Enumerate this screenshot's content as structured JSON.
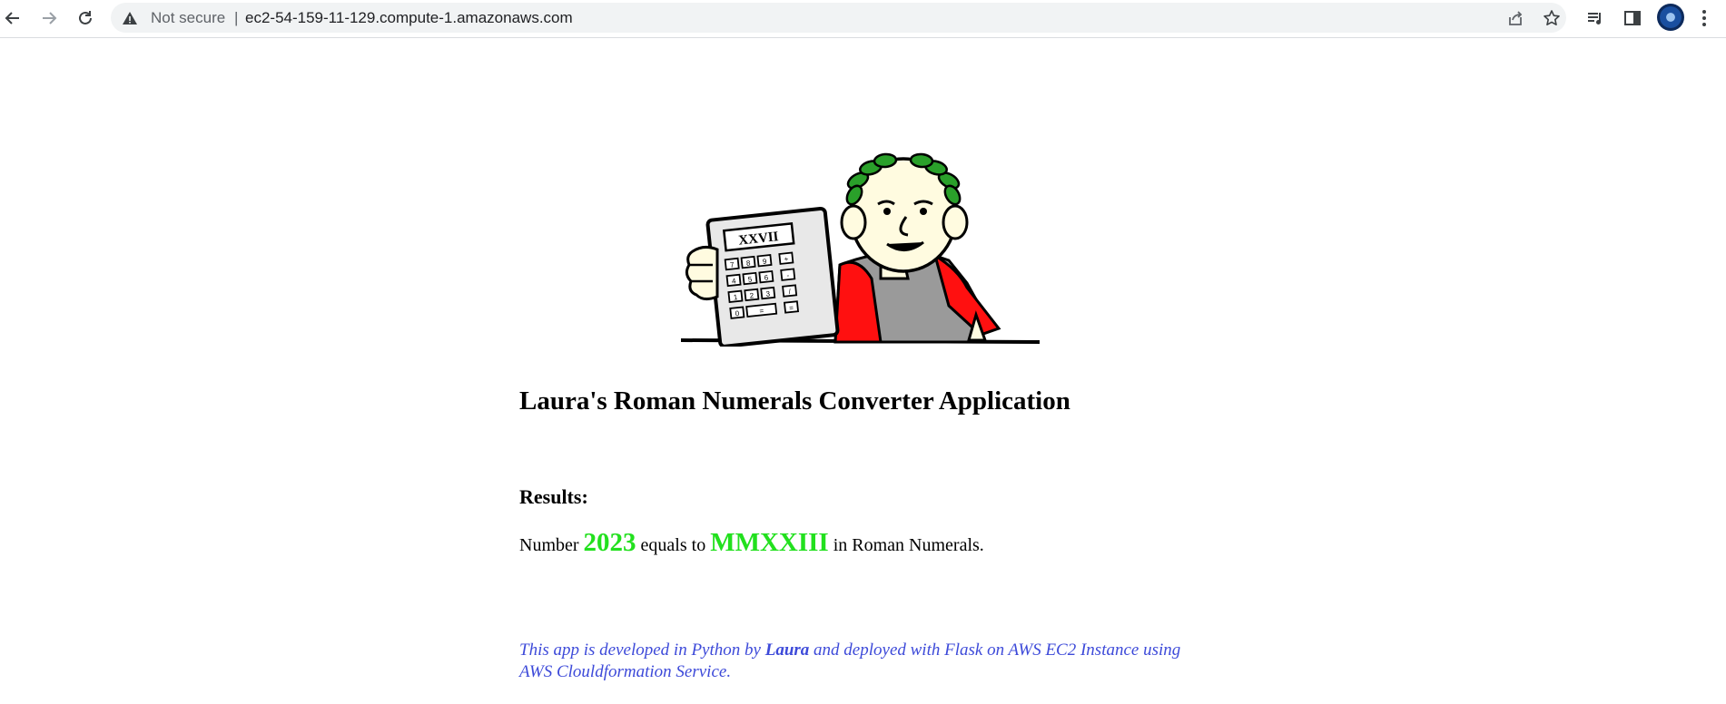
{
  "browser": {
    "security_label": "Not secure",
    "separator": "|",
    "url": "ec2-54-159-11-129.compute-1.amazonaws.com",
    "icons": [
      "back-icon",
      "forward-icon",
      "reload-icon",
      "warning-icon",
      "share-icon",
      "star-icon",
      "media-control-icon",
      "side-panel-icon",
      "profile-avatar",
      "menu-icon"
    ]
  },
  "hero": {
    "calculator_display": "XXVII",
    "keys": [
      "7",
      "8",
      "9",
      "+",
      "4",
      "5",
      "6",
      "-",
      "1",
      "2",
      "3",
      "/",
      "0",
      "=",
      "="
    ]
  },
  "page": {
    "title": "Laura's Roman Numerals Converter Application",
    "results_label": "Results:",
    "result_prefix": "Number",
    "result_number": "2023",
    "result_middle": "equals to",
    "result_roman": "MMXXIII",
    "result_suffix": "in Roman Numerals.",
    "footer_part1": "This app is developed in Python by",
    "footer_author": "Laura",
    "footer_part2": "and deployed with Flask on AWS EC2 Instance using AWS Clouldformation Service."
  },
  "colors": {
    "result_green": "#22e01e",
    "footer_blue": "#3d4ad9"
  }
}
